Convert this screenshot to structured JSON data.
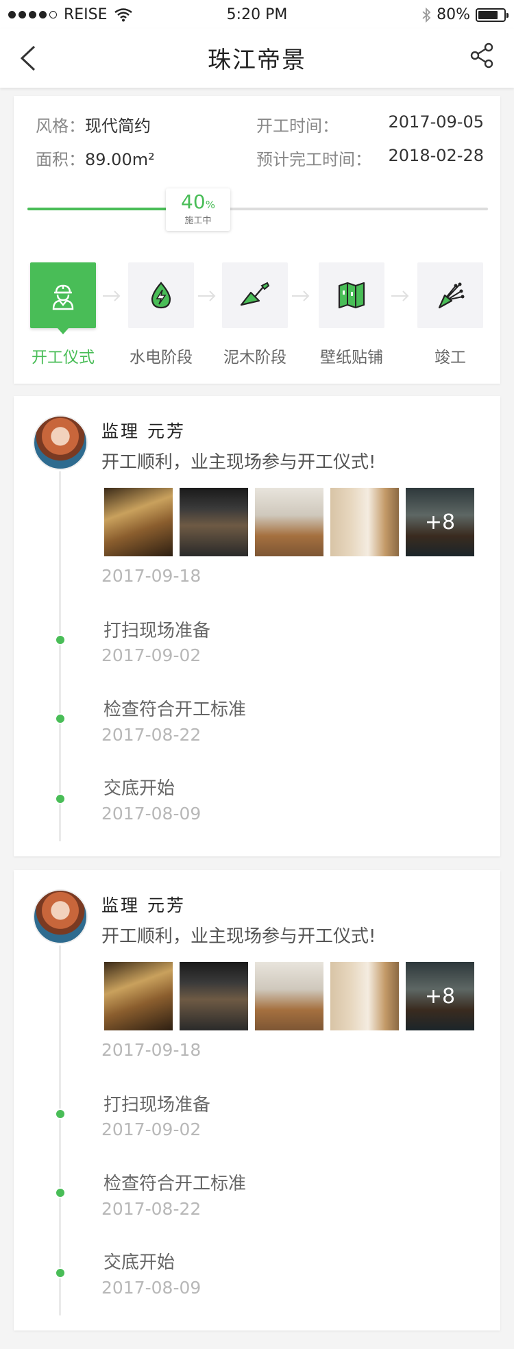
{
  "status_bar": {
    "carrier": "REISE",
    "time": "5:20 PM",
    "battery": "80%",
    "battery_level": 0.8
  },
  "nav": {
    "title": "珠江帝景"
  },
  "info": {
    "style_label": "风格：",
    "style_value": "现代简约",
    "area_label": "面积：",
    "area_value": "89.00m²",
    "start_label": "开工时间：",
    "start_value": "2017-09-05",
    "end_label": "预计完工时间：",
    "end_value": "2018-02-28"
  },
  "progress": {
    "percent": "40",
    "percent_unit": "%",
    "status": "施工中",
    "value": 0.4
  },
  "stages": [
    {
      "label": "开工仪式",
      "icon": "worker-icon",
      "active": true
    },
    {
      "label": "水电阶段",
      "icon": "water-electric-icon",
      "active": false
    },
    {
      "label": "泥木阶段",
      "icon": "trowel-icon",
      "active": false
    },
    {
      "label": "壁纸贴铺",
      "icon": "wallpaper-icon",
      "active": false
    },
    {
      "label": "竣工",
      "icon": "bouquet-icon",
      "active": false
    }
  ],
  "logs": [
    {
      "author": "监理 元芳",
      "text": "开工顺利，业主现场参与开工仪式!",
      "more_photos": "+8",
      "date": "2017-09-18",
      "steps": [
        {
          "title": "打扫现场准备",
          "date": "2017-09-02"
        },
        {
          "title": "检查符合开工标准",
          "date": "2017-08-22"
        },
        {
          "title": "交底开始",
          "date": "2017-08-09"
        }
      ]
    },
    {
      "author": "监理 元芳",
      "text": "开工顺利，业主现场参与开工仪式!",
      "more_photos": "+8",
      "date": "2017-09-18",
      "steps": [
        {
          "title": "打扫现场准备",
          "date": "2017-09-02"
        },
        {
          "title": "检查符合开工标准",
          "date": "2017-08-22"
        },
        {
          "title": "交底开始",
          "date": "2017-08-09"
        }
      ]
    }
  ],
  "colors": {
    "accent": "#49bd57",
    "muted": "#b8b8b8"
  }
}
